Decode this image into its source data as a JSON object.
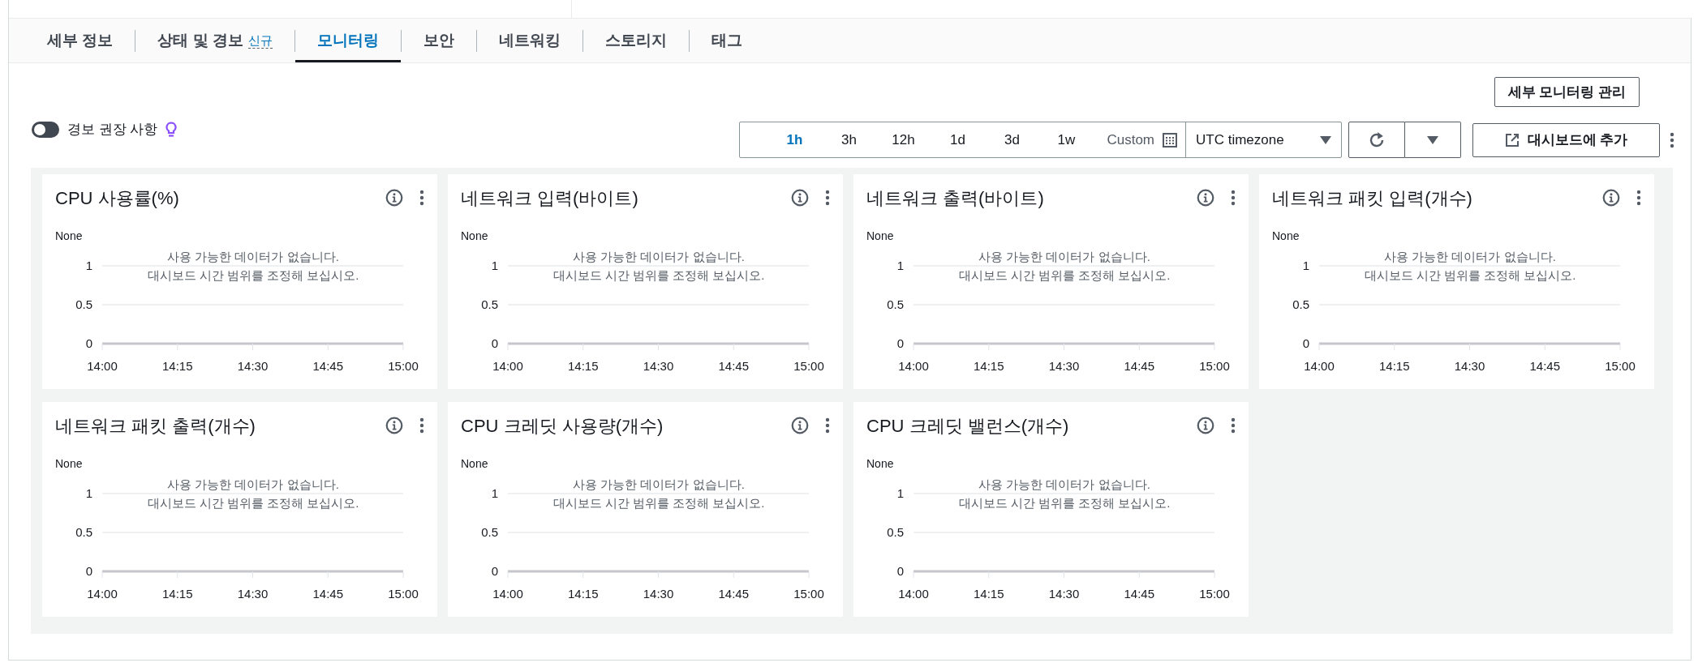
{
  "tabs": [
    {
      "label": "세부 정보",
      "selected": false
    },
    {
      "label": "상태 및 경보",
      "badge": "신규",
      "selected": false
    },
    {
      "label": "모니터링",
      "selected": true
    },
    {
      "label": "보안",
      "selected": false
    },
    {
      "label": "네트워킹",
      "selected": false
    },
    {
      "label": "스토리지",
      "selected": false
    },
    {
      "label": "태그",
      "selected": false
    }
  ],
  "alarm_recommendations": {
    "label": "경보 권장 사항",
    "on": false
  },
  "manage_button": "세부 모니터링 관리",
  "time_ranges": [
    {
      "label": "1h",
      "selected": true,
      "kind": "preset"
    },
    {
      "label": "3h",
      "selected": false,
      "kind": "preset"
    },
    {
      "label": "12h",
      "selected": false,
      "kind": "preset"
    },
    {
      "label": "1d",
      "selected": false,
      "kind": "preset"
    },
    {
      "label": "3d",
      "selected": false,
      "kind": "preset"
    },
    {
      "label": "1w",
      "selected": false,
      "kind": "preset"
    },
    {
      "label": "Custom",
      "selected": false,
      "kind": "custom"
    }
  ],
  "timezone": "UTC timezone",
  "add_button": "대시보드에 추가",
  "widgets": [
    {
      "title": "CPU 사용률(%)",
      "message": [
        "사용 가능한 데이터가 없습니다.",
        "대시보드 시간 범위를 조정해 보십시오."
      ],
      "chart_data": {
        "type": "line",
        "ylabel": "None",
        "categories": [
          "14:00",
          "14:15",
          "14:30",
          "14:45",
          "15:00"
        ],
        "ylim": [
          0,
          1
        ],
        "yticks": [
          0,
          0.5,
          1
        ]
      }
    },
    {
      "title": "네트워크 입력(바이트)",
      "message": [
        "사용 가능한 데이터가 없습니다.",
        "대시보드 시간 범위를 조정해 보십시오."
      ],
      "chart_data": {
        "type": "line",
        "ylabel": "None",
        "categories": [
          "14:00",
          "14:15",
          "14:30",
          "14:45",
          "15:00"
        ],
        "ylim": [
          0,
          1
        ],
        "yticks": [
          0,
          0.5,
          1
        ]
      }
    },
    {
      "title": "네트워크 출력(바이트)",
      "message": [
        "사용 가능한 데이터가 없습니다.",
        "대시보드 시간 범위를 조정해 보십시오."
      ],
      "chart_data": {
        "type": "line",
        "ylabel": "None",
        "categories": [
          "14:00",
          "14:15",
          "14:30",
          "14:45",
          "15:00"
        ],
        "ylim": [
          0,
          1
        ],
        "yticks": [
          0,
          0.5,
          1
        ]
      }
    },
    {
      "title": "네트워크 패킷 입력(개수)",
      "message": [
        "사용 가능한 데이터가 없습니다.",
        "대시보드 시간 범위를 조정해 보십시오."
      ],
      "chart_data": {
        "type": "line",
        "ylabel": "None",
        "categories": [
          "14:00",
          "14:15",
          "14:30",
          "14:45",
          "15:00"
        ],
        "ylim": [
          0,
          1
        ],
        "yticks": [
          0,
          0.5,
          1
        ]
      }
    },
    {
      "title": "네트워크 패킷 출력(개수)",
      "message": [
        "사용 가능한 데이터가 없습니다.",
        "대시보드 시간 범위를 조정해 보십시오."
      ],
      "chart_data": {
        "type": "line",
        "ylabel": "None",
        "categories": [
          "14:00",
          "14:15",
          "14:30",
          "14:45",
          "15:00"
        ],
        "ylim": [
          0,
          1
        ],
        "yticks": [
          0,
          0.5,
          1
        ]
      }
    },
    {
      "title": "CPU 크레딧 사용량(개수)",
      "message": [
        "사용 가능한 데이터가 없습니다.",
        "대시보드 시간 범위를 조정해 보십시오."
      ],
      "chart_data": {
        "type": "line",
        "ylabel": "None",
        "categories": [
          "14:00",
          "14:15",
          "14:30",
          "14:45",
          "15:00"
        ],
        "ylim": [
          0,
          1
        ],
        "yticks": [
          0,
          0.5,
          1
        ]
      }
    },
    {
      "title": "CPU 크레딧 밸런스(개수)",
      "message": [
        "사용 가능한 데이터가 없습니다.",
        "대시보드 시간 범위를 조정해 보십시오."
      ],
      "chart_data": {
        "type": "line",
        "ylabel": "None",
        "categories": [
          "14:00",
          "14:15",
          "14:30",
          "14:45",
          "15:00"
        ],
        "ylim": [
          0,
          1
        ],
        "yticks": [
          0,
          0.5,
          1
        ]
      }
    }
  ]
}
